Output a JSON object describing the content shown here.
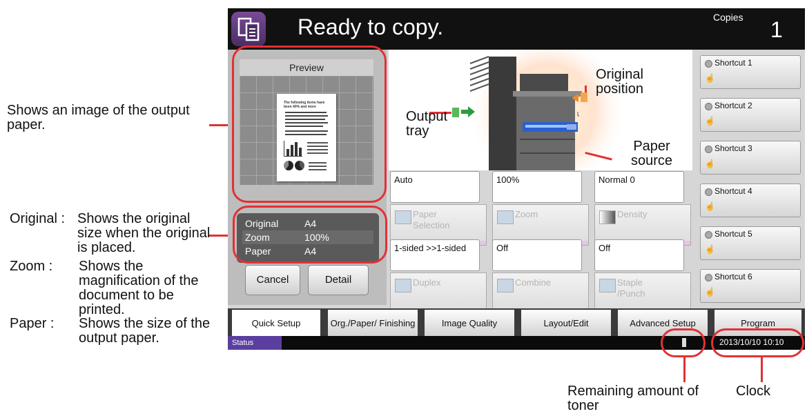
{
  "callouts": {
    "preview_desc": "Shows an image of the output paper.",
    "original_label": "Original :",
    "original_desc": "Shows the original size when the original is placed.",
    "zoom_label": "Zoom :",
    "zoom_desc": "Shows the magnification of the document to be printed.",
    "paper_label": "Paper :",
    "paper_desc": "Shows the size of the output paper.",
    "toner": "Remaining amount of toner",
    "clock": "Clock"
  },
  "header": {
    "title": "Ready to copy.",
    "copies_label": "Copies",
    "copies_value": "1"
  },
  "preview": {
    "label": "Preview",
    "doc_heading": "The following items have been 40% and more"
  },
  "info": {
    "original_label": "Original",
    "original_value": "A4",
    "zoom_label": "Zoom",
    "zoom_value": "100%",
    "paper_label": "Paper",
    "paper_value": "A4"
  },
  "buttons": {
    "cancel": "Cancel",
    "detail": "Detail"
  },
  "diagram": {
    "output_tray": "Output tray",
    "original_position": "Original position",
    "paper_source": "Paper source"
  },
  "settings": [
    {
      "value": "Auto",
      "name": "Paper Selection"
    },
    {
      "value": "100%",
      "name": "Zoom"
    },
    {
      "value": "Normal 0",
      "name": "Density"
    },
    {
      "value": "1-sided >>1-sided",
      "name": "Duplex"
    },
    {
      "value": "Off",
      "name": "Combine"
    },
    {
      "value": "Off",
      "name": "Staple /Punch"
    }
  ],
  "shortcuts": [
    "Shortcut 1",
    "Shortcut 2",
    "Shortcut 3",
    "Shortcut 4",
    "Shortcut 5",
    "Shortcut 6"
  ],
  "tabs": [
    "Quick Setup",
    "Org./Paper/ Finishing",
    "Image Quality",
    "Layout/Edit",
    "Advanced Setup",
    "Program"
  ],
  "statusbar": {
    "status": "Status",
    "datetime": "2013/10/10  10:10"
  },
  "colors": {
    "callout_red": "#e33034",
    "status_purple": "#5a3fa0"
  }
}
